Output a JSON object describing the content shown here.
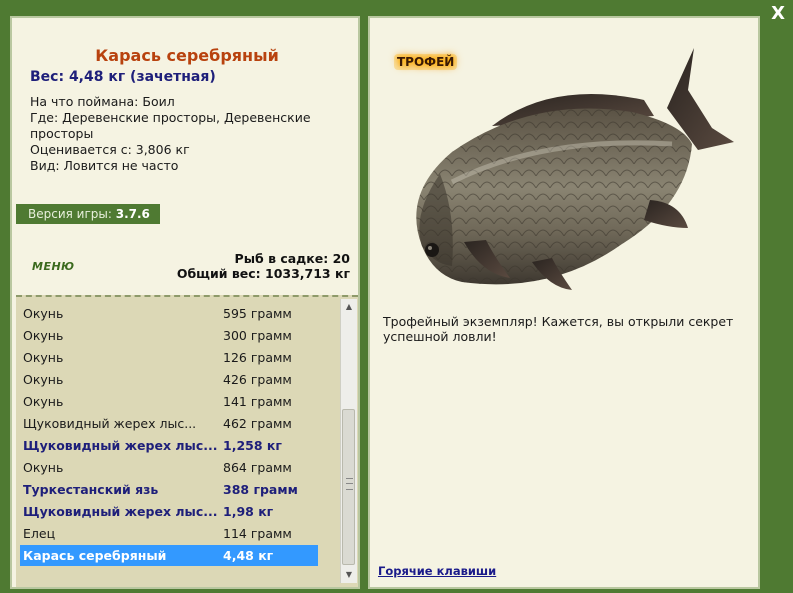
{
  "window": {
    "close_label": "X"
  },
  "fish": {
    "title": "Карась серебряный",
    "weight_line": "Вес: 4,48 кг (зачетная)",
    "bait_line": "На что поймана: Боил",
    "place_line": "Где: Деревенские просторы, Деревенские просторы",
    "price_line": "Оценивается с: 3,806 кг",
    "kind_line": "Вид: Ловится не часто"
  },
  "version": {
    "label": "Версия игры:",
    "value": "3.7.6"
  },
  "menu": {
    "label": "МЕНЮ"
  },
  "keep_net": {
    "count_line": "Рыб в садке: 20",
    "total_line": "Общий вес: 1033,713 кг"
  },
  "catch_list": [
    {
      "name": "Окунь",
      "weight": "595 грамм",
      "trophy": false,
      "selected": false
    },
    {
      "name": "Окунь",
      "weight": "300 грамм",
      "trophy": false,
      "selected": false
    },
    {
      "name": "Окунь",
      "weight": "126 грамм",
      "trophy": false,
      "selected": false
    },
    {
      "name": "Окунь",
      "weight": "426 грамм",
      "trophy": false,
      "selected": false
    },
    {
      "name": "Окунь",
      "weight": "141 грамм",
      "trophy": false,
      "selected": false
    },
    {
      "name": "Щуковидный жерех лыс...",
      "weight": "462 грамм",
      "trophy": false,
      "selected": false
    },
    {
      "name": "Щуковидный жерех лыс...",
      "weight": "1,258 кг",
      "trophy": true,
      "selected": false
    },
    {
      "name": "Окунь",
      "weight": "864 грамм",
      "trophy": false,
      "selected": false
    },
    {
      "name": "Туркестанский язь",
      "weight": "388 грамм",
      "trophy": true,
      "selected": false
    },
    {
      "name": "Щуковидный жерех лыс...",
      "weight": "1,98 кг",
      "trophy": true,
      "selected": false
    },
    {
      "name": "Елец",
      "weight": "114 грамм",
      "trophy": false,
      "selected": false
    },
    {
      "name": "Карась серебряный",
      "weight": "4,48 кг",
      "trophy": true,
      "selected": true
    }
  ],
  "detail": {
    "badge": "ТРОФЕЙ",
    "text": "Трофейный экземпляр! Кажется, вы открыли секрет успешной ловли!",
    "hotkeys_label": "Горячие клавиши"
  },
  "colors": {
    "background": "#4f7a32",
    "panel": "#f5f3e2",
    "list_bg": "#dcd8b6",
    "title": "#b8420e",
    "trophy_text": "#1e1f7a",
    "selected_row": "#3399ff"
  }
}
